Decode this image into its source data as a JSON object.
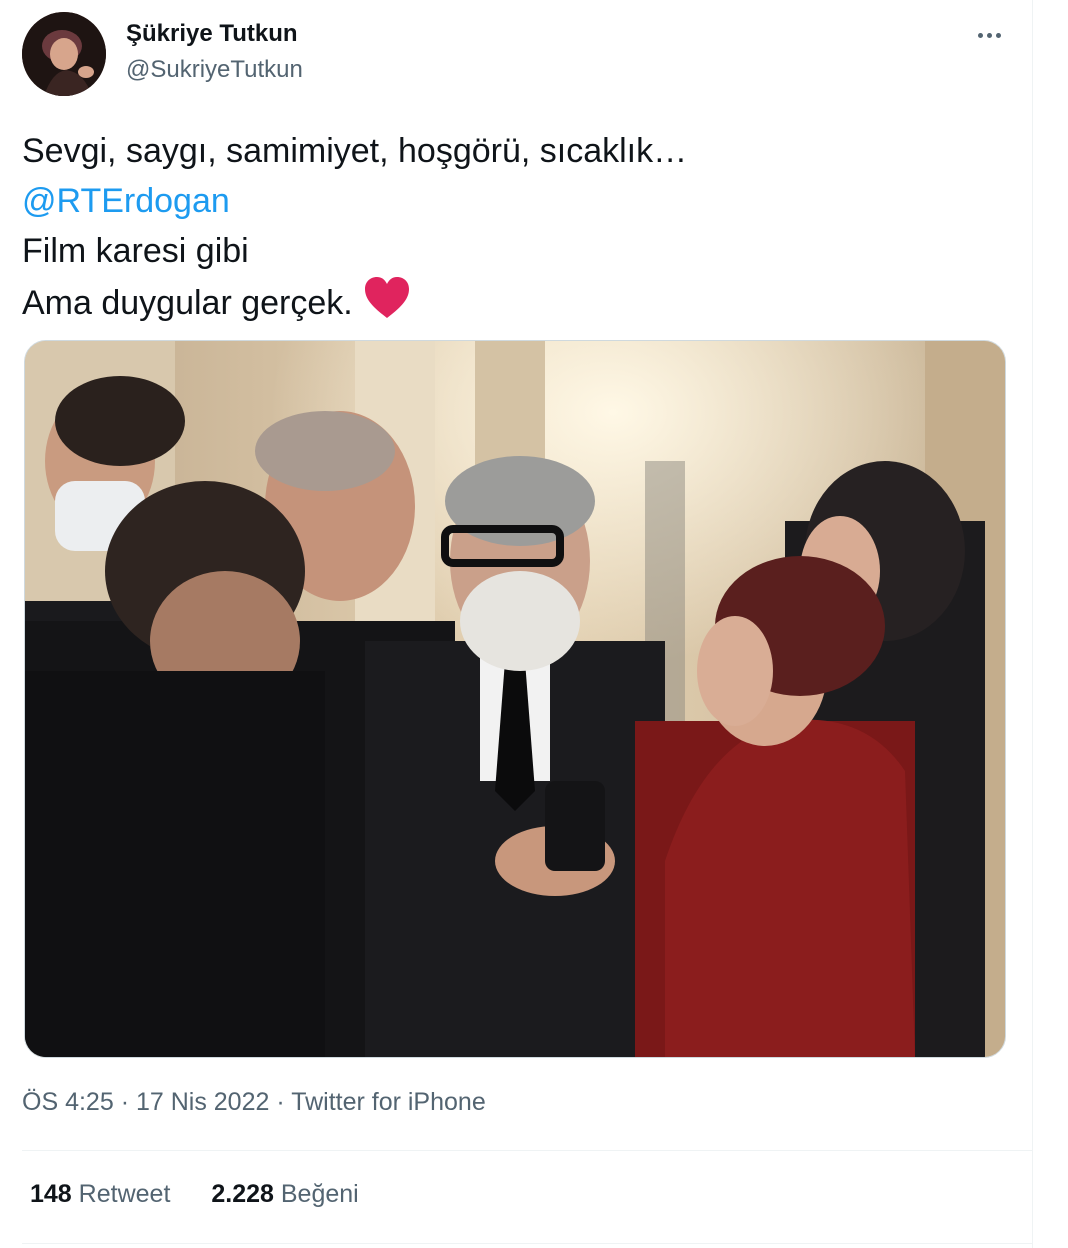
{
  "author": {
    "display_name": "Şükriye Tutkun",
    "handle": "@SukriyeTutkun"
  },
  "tweet": {
    "lines": [
      "Sevgi, saygı, samimiyet, hoşgörü, sıcaklık…",
      "@RTErdogan",
      "Film karesi gibi",
      "Ama duygular gerçek."
    ],
    "mention_color": "#1d9bf0",
    "emoji": "heart-icon"
  },
  "meta": {
    "time": "ÖS 4:25",
    "separator": "·",
    "date": "17 Nis 2022",
    "source": "Twitter for iPhone"
  },
  "stats": {
    "retweets_count": "148",
    "retweets_label": "Retweet",
    "likes_count": "2.228",
    "likes_label": "Beğeni"
  },
  "icons": {
    "more": "more-options-icon",
    "heart": "heart-icon"
  },
  "colors": {
    "accent": "#1d9bf0",
    "heart": "#e0245e",
    "secondary_text": "#536471"
  }
}
